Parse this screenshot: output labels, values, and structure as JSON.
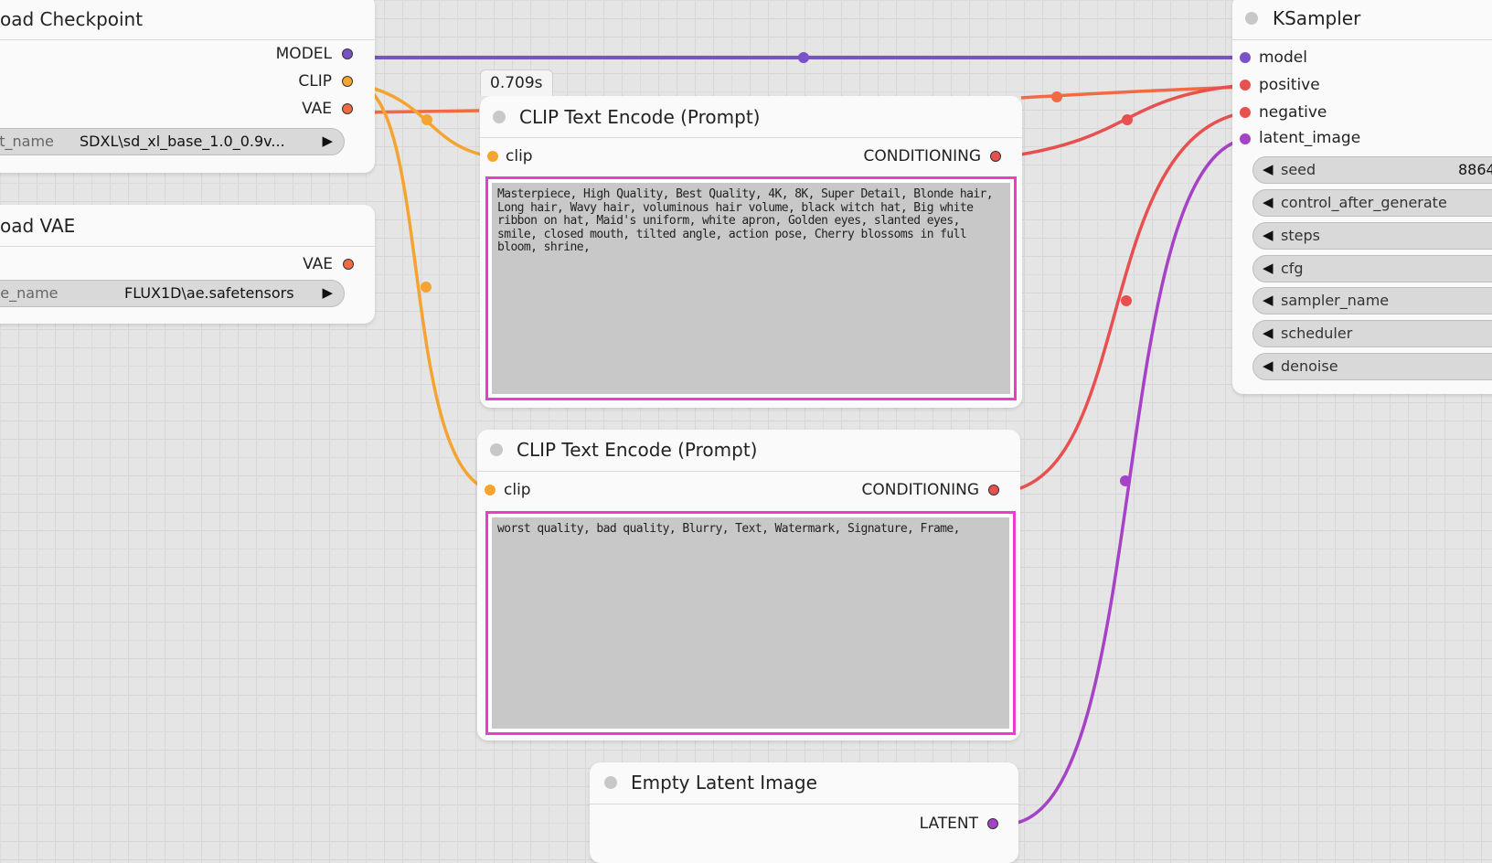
{
  "colors": {
    "model": "#7a52c8",
    "clip": "#f5a431",
    "vae": "#f26a42",
    "conditioning": "#e8504f",
    "latent": "#a542c6",
    "textarea_border": "#e83ec9"
  },
  "load_checkpoint": {
    "title": "oad Checkpoint",
    "outputs": [
      "MODEL",
      "CLIP",
      "VAE"
    ],
    "widget": {
      "name": "ckpt_name",
      "value": "SDXL\\sd_xl_base_1.0_0.9v..."
    }
  },
  "load_vae": {
    "title": "oad VAE",
    "outputs": [
      "VAE"
    ],
    "widget": {
      "name": "vae_name",
      "value": "FLUX1D\\ae.safetensors"
    }
  },
  "timing_badge": "0.709s",
  "clip_encode_positive": {
    "title": "CLIP Text Encode (Prompt)",
    "input": "clip",
    "output": "CONDITIONING",
    "text": "Masterpiece, High Quality, Best Quality, 4K, 8K, Super Detail, Blonde hair, Long hair, Wavy hair, voluminous hair volume, black witch hat, Big white ribbon on hat, Maid's uniform, white apron, Golden eyes, slanted eyes, smile, closed mouth, tilted angle, action pose, Cherry blossoms in full bloom, shrine,"
  },
  "clip_encode_negative": {
    "title": "CLIP Text Encode (Prompt)",
    "input": "clip",
    "output": "CONDITIONING",
    "text": "worst quality, bad quality, Blurry, Text, Watermark, Signature, Frame,"
  },
  "empty_latent": {
    "title": "Empty Latent Image",
    "output": "LATENT"
  },
  "ksampler": {
    "title": "KSampler",
    "inputs": [
      "model",
      "positive",
      "negative",
      "latent_image"
    ],
    "widgets": [
      {
        "name": "seed",
        "value": "8864"
      },
      {
        "name": "control_after_generate",
        "value": ""
      },
      {
        "name": "steps",
        "value": ""
      },
      {
        "name": "cfg",
        "value": ""
      },
      {
        "name": "sampler_name",
        "value": ""
      },
      {
        "name": "scheduler",
        "value": ""
      },
      {
        "name": "denoise",
        "value": ""
      }
    ]
  }
}
